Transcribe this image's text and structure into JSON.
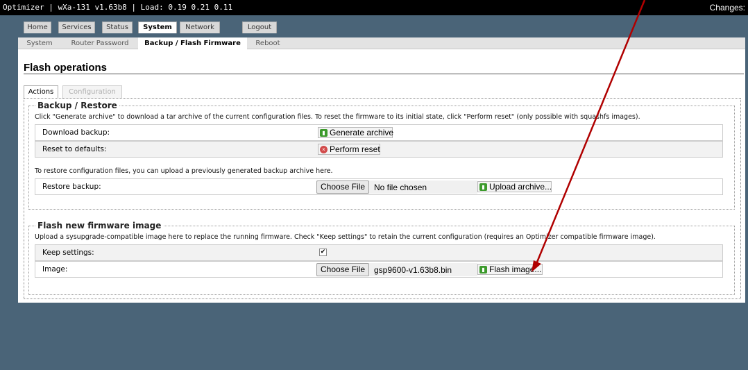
{
  "topbar": {
    "status_text": "Optimizer | wXa-131 v1.63b8 | Load: 0.19 0.21 0.11",
    "changes_label": "Changes:"
  },
  "main_tabs": [
    "Home",
    "Services",
    "Status",
    "System",
    "Network",
    "Logout"
  ],
  "sub_tabs": [
    "System",
    "Router Password",
    "Backup / Flash Firmware",
    "Reboot"
  ],
  "page_title": "Flash operations",
  "content_tabs": {
    "actions": "Actions",
    "configuration": "Configuration"
  },
  "backup_restore": {
    "legend": "Backup / Restore",
    "description": "Click \"Generate archive\" to download a tar archive of the current configuration files. To reset the firmware to its initial state, click \"Perform reset\" (only possible with squashfs images).",
    "download_label": "Download backup:",
    "generate_button": "Generate archive",
    "reset_label": "Reset to defaults:",
    "reset_button": "Perform reset",
    "restore_description": "To restore configuration files, you can upload a previously generated backup archive here.",
    "restore_label": "Restore backup:",
    "choose_file": "Choose File",
    "no_file": "No file chosen",
    "upload_button": "Upload archive..."
  },
  "flash": {
    "legend": "Flash new firmware image",
    "description": "Upload a sysupgrade-compatible image here to replace the running firmware. Check \"Keep settings\" to retain the current configuration (requires an Optimizer compatible firmware image).",
    "keep_label": "Keep settings:",
    "keep_checked": true,
    "image_label": "Image:",
    "choose_file": "Choose File",
    "file_name": "gsp9600-v1.63b8.bin",
    "flash_button": "Flash image..."
  },
  "colors": {
    "background": "#4a6478",
    "annotation_arrow": "#b00000",
    "button_icon_green": "#3c9a2c",
    "button_icon_red": "#d24b4b"
  }
}
